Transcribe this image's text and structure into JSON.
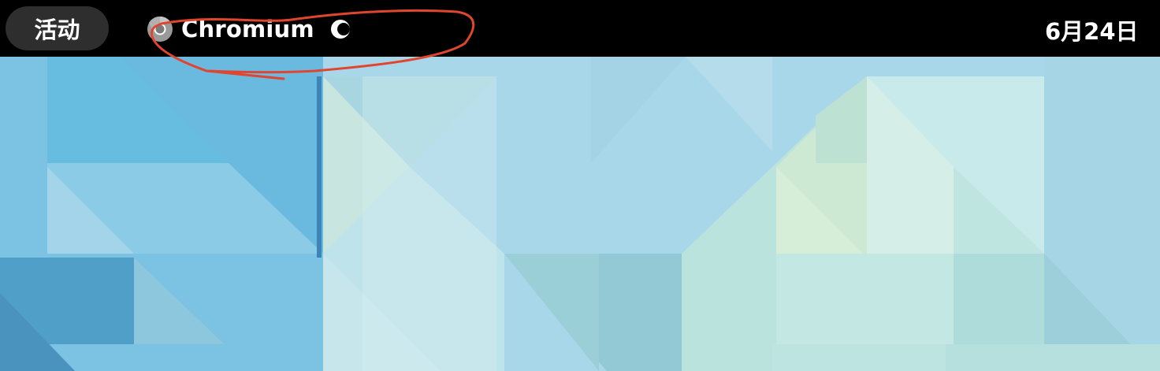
{
  "top_bar": {
    "activities_label": "活动",
    "app_menu": {
      "app_name": "Chromium",
      "app_icon": "chromium-icon",
      "status_icon": "loading-spinner-icon"
    },
    "clock_text": "6月24日 "
  },
  "annotation": {
    "shape": "hand-drawn-ellipse",
    "color": "#e0452f"
  },
  "wallpaper": {
    "style": "geometric-triangles",
    "colors": [
      "#a9d7ea",
      "#6ab9df",
      "#bfe6ec",
      "#cbe9d7",
      "#8fc8dd"
    ]
  }
}
